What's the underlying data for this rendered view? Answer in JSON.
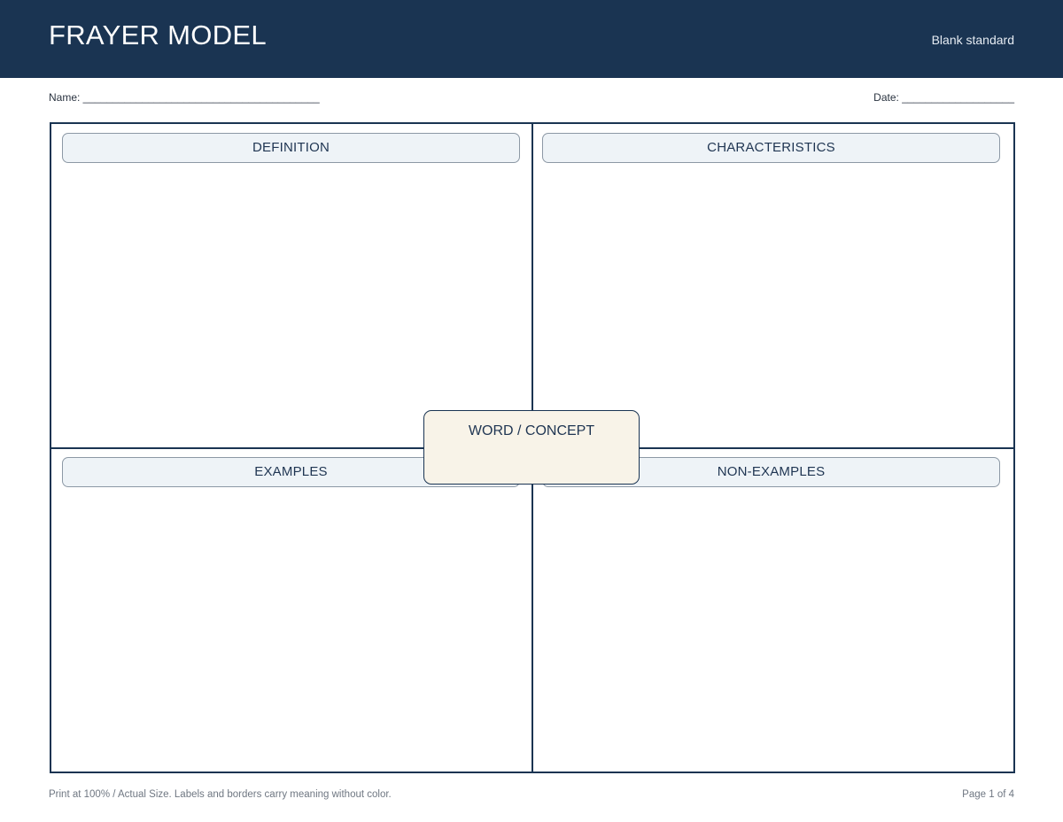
{
  "header": {
    "title": "FRAYER MODEL",
    "subtitle": "Blank standard",
    "background_color": "#1a3452"
  },
  "fields": {
    "name": "Name: ________________________________________",
    "date": "Date: ___________________"
  },
  "quadrants": {
    "definition": "DEFINITION",
    "characteristics": "CHARACTERISTICS",
    "examples": "EXAMPLES",
    "non_examples": "NON-EXAMPLES"
  },
  "center": {
    "label": "WORD / CONCEPT",
    "fill_color": "#f8f3e8"
  },
  "footer": {
    "note": "Print at 100% / Actual Size. Labels and borders carry meaning without color.",
    "page": "Page 1 of 4"
  }
}
